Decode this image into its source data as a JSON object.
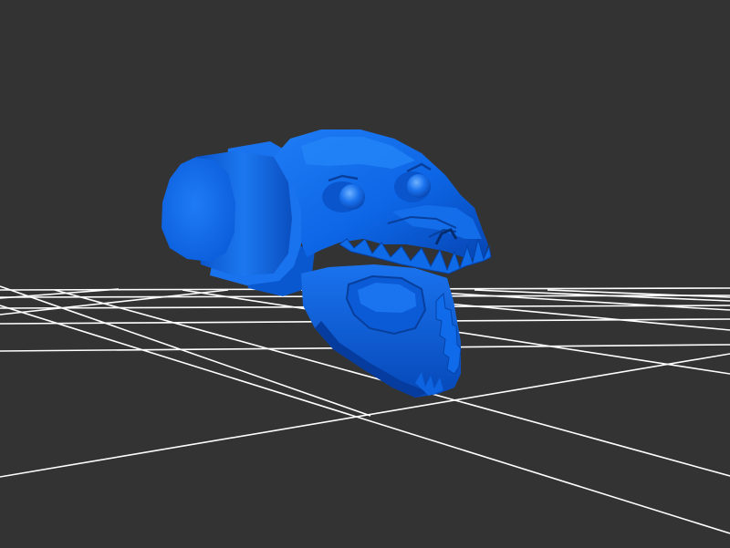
{
  "scene": {
    "background_color": "#333333",
    "grid_color": "#ffffff",
    "model_color": "#0a64e6",
    "model": "creature-skull-with-open-jaw",
    "grid_visible": true
  }
}
